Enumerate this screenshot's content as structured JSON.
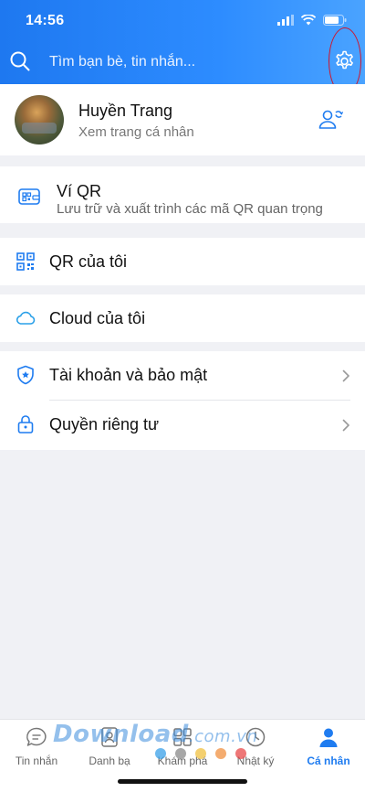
{
  "status_bar": {
    "time": "14:56"
  },
  "search": {
    "placeholder": "Tìm bạn bè, tin nhắn..."
  },
  "profile": {
    "name": "Huyền Trang",
    "subtitle": "Xem trang cá nhân"
  },
  "qr_wallet": {
    "title": "Ví QR",
    "subtitle": "Lưu trữ và xuất trình các mã QR quan trọng"
  },
  "menu": {
    "my_qr": "QR của tôi",
    "my_cloud": "Cloud của tôi",
    "account_security": "Tài khoản và bảo mật",
    "privacy": "Quyền riêng tư"
  },
  "bottom_nav": [
    {
      "label": "Tin nhắn",
      "icon": "chat-bubble-icon"
    },
    {
      "label": "Danh bạ",
      "icon": "contacts-icon"
    },
    {
      "label": "Khám phá",
      "icon": "grid-icon"
    },
    {
      "label": "Nhật ký",
      "icon": "clock-icon"
    },
    {
      "label": "Cá nhân",
      "icon": "person-icon",
      "active": true
    }
  ],
  "watermark": {
    "main": "Download",
    "suffix": ".com.vn",
    "dot_colors": [
      "#3aa0e8",
      "#8a8a8a",
      "#f0c040",
      "#f09040",
      "#e84a4a"
    ]
  },
  "colors": {
    "accent": "#1f7cf0",
    "header_start": "#1e78f0",
    "header_end": "#4aa3ff",
    "highlight": "#d0142c"
  }
}
